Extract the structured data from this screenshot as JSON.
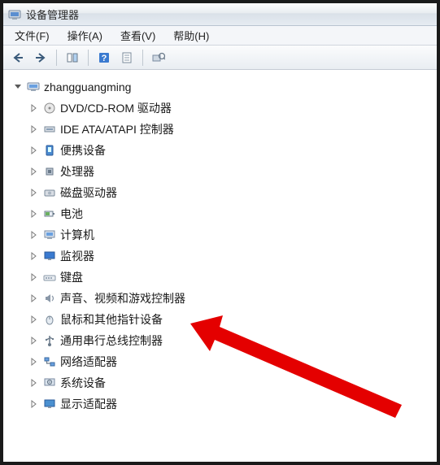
{
  "window": {
    "title": "设备管理器"
  },
  "menu": {
    "file": "文件(F)",
    "action": "操作(A)",
    "view": "查看(V)",
    "help": "帮助(H)"
  },
  "toolbar": {
    "back": "back",
    "forward": "forward",
    "show_hide": "show-hide",
    "help": "help",
    "properties": "properties",
    "scan": "scan"
  },
  "tree": {
    "root": {
      "label": "zhangguangming",
      "icon": "computer-icon"
    },
    "items": [
      {
        "label": "DVD/CD-ROM 驱动器",
        "icon": "disc-icon"
      },
      {
        "label": "IDE ATA/ATAPI 控制器",
        "icon": "ide-icon"
      },
      {
        "label": "便携设备",
        "icon": "portable-icon"
      },
      {
        "label": "处理器",
        "icon": "cpu-icon"
      },
      {
        "label": "磁盘驱动器",
        "icon": "disk-icon"
      },
      {
        "label": "电池",
        "icon": "battery-icon"
      },
      {
        "label": "计算机",
        "icon": "pc-icon"
      },
      {
        "label": "监视器",
        "icon": "monitor-icon"
      },
      {
        "label": "键盘",
        "icon": "keyboard-icon"
      },
      {
        "label": "声音、视频和游戏控制器",
        "icon": "sound-icon"
      },
      {
        "label": "鼠标和其他指针设备",
        "icon": "mouse-icon"
      },
      {
        "label": "通用串行总线控制器",
        "icon": "usb-icon"
      },
      {
        "label": "网络适配器",
        "icon": "network-icon"
      },
      {
        "label": "系统设备",
        "icon": "system-icon"
      },
      {
        "label": "显示适配器",
        "icon": "display-icon"
      }
    ]
  }
}
